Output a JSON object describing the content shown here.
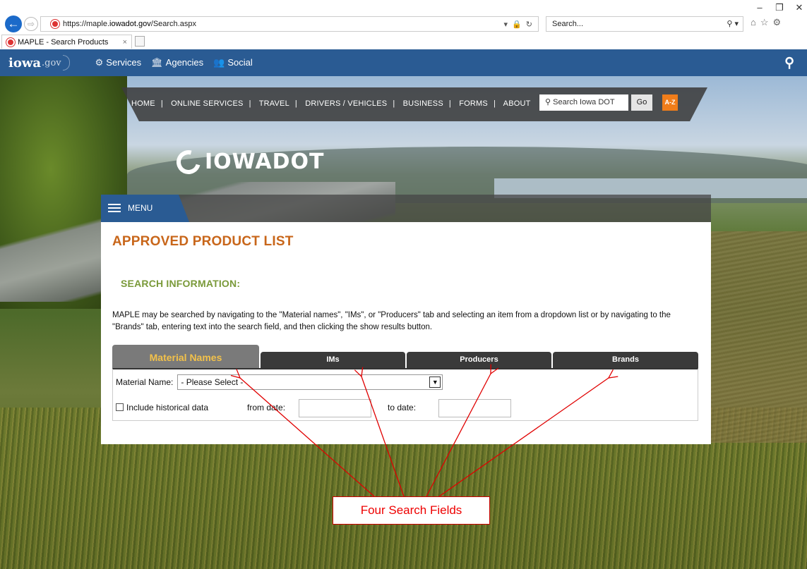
{
  "browser": {
    "url_prefix": "https://maple.",
    "url_domain": "iowadot.gov",
    "url_path": "/Search.aspx",
    "search_placeholder": "Search...",
    "tab_title": "MAPLE - Search Products",
    "tab_close": "×",
    "win_minimize": "–",
    "win_restore": "❐",
    "win_close": "✕"
  },
  "gov_bar": {
    "logo": "iowa",
    "logo_suffix": ".gov",
    "nav": [
      {
        "icon": "⚙",
        "label": "Services"
      },
      {
        "icon": "🏛",
        "label": "Agencies"
      },
      {
        "icon": "👥",
        "label": "Social"
      }
    ]
  },
  "topnav": {
    "links": [
      "HOME",
      "ONLINE SERVICES",
      "TRAVEL",
      "DRIVERS / VEHICLES",
      "BUSINESS",
      "FORMS",
      "ABOUT"
    ],
    "search_placeholder": "Search Iowa DOT",
    "go_label": "Go",
    "az_label": "A-Z"
  },
  "logo_text": "IOWADOT",
  "menu_label": "MENU",
  "page": {
    "title": "APPROVED PRODUCT LIST",
    "section_title": "SEARCH INFORMATION:",
    "intro": "MAPLE may be searched by navigating to the \"Material names\", \"IMs\", or \"Producers\" tab and selecting an item from a dropdown list or by navigating to the \"Brands\" tab, entering text into the search field, and then clicking the show results button."
  },
  "tabs": [
    {
      "label": "Material Names",
      "active": true
    },
    {
      "label": "IMs",
      "active": false
    },
    {
      "label": "Producers",
      "active": false
    },
    {
      "label": "Brands",
      "active": false
    }
  ],
  "form": {
    "material_label": "Material Name:",
    "material_value": "- Please Select -",
    "historical_label": "Include historical data",
    "from_label": "from date:",
    "to_label": "to date:",
    "from_value": "",
    "to_value": ""
  },
  "annotation": {
    "callout": "Four Search Fields",
    "color": "#e00000"
  }
}
